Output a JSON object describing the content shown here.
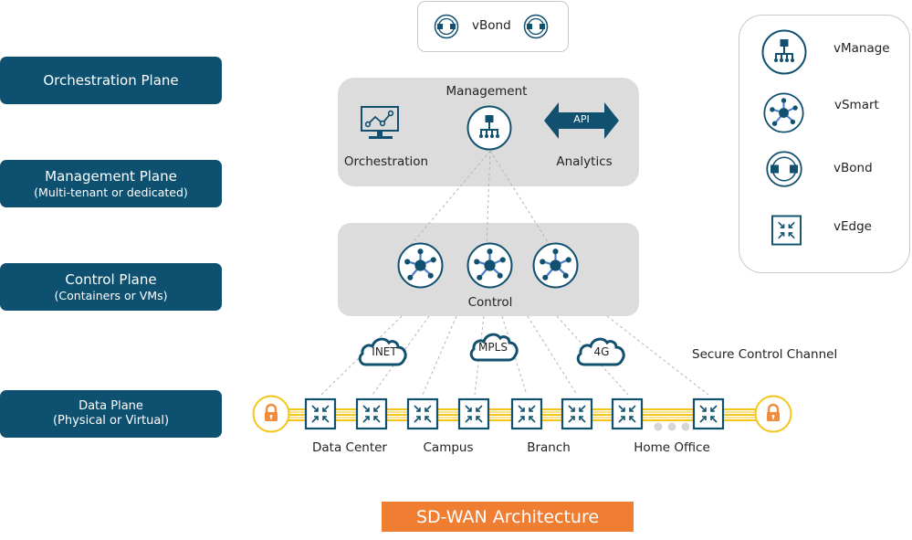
{
  "planes": [
    {
      "title": "Orchestration Plane",
      "subtitle": ""
    },
    {
      "title": "Management Plane",
      "subtitle": "(Multi-tenant or dedicated)"
    },
    {
      "title": "Control Plane",
      "subtitle": "(Containers or VMs)"
    },
    {
      "title": "Data Plane",
      "subtitle": "(Physical or Virtual)"
    }
  ],
  "vbond_box": {
    "label": "vBond",
    "icon": "vbond-icon"
  },
  "management_box": {
    "title": "Management",
    "orchestration_label": "Orchestration",
    "analytics_label": "Analytics",
    "api_label": "API",
    "icons": [
      "monitor-chart-icon",
      "vmanage-icon",
      "api-arrow-icon"
    ]
  },
  "control_box": {
    "label": "Control",
    "vsmart_count": 3
  },
  "transports": [
    {
      "label": "INET",
      "icon": "cloud-icon"
    },
    {
      "label": "MPLS",
      "icon": "cloud-icon"
    },
    {
      "label": "4G",
      "icon": "cloud-icon"
    }
  ],
  "secure_channel_label": "Secure Control Channel",
  "sites": [
    {
      "label": "Data Center",
      "vedge_count": 2
    },
    {
      "label": "Campus",
      "vedge_count": 2
    },
    {
      "label": "Branch",
      "vedge_count": 2
    },
    {
      "label": "Home Office",
      "vedge_count": 2
    }
  ],
  "legend": [
    {
      "label": "vManage",
      "icon": "vmanage-icon"
    },
    {
      "label": "vSmart",
      "icon": "vsmart-icon"
    },
    {
      "label": "vBond",
      "icon": "vbond-icon"
    },
    {
      "label": "vEdge",
      "icon": "vedge-icon"
    }
  ],
  "banner": "SD-WAN Architecture",
  "colors": {
    "plane_bg": "#0e5070",
    "icon_blue": "#11506f",
    "spoke_blue": "#4a7fd0",
    "box_gray": "#dcdcdc",
    "transport_yellow": "#f5c518",
    "lock_orange": "#f08c3c",
    "banner_orange": "#ef7d32"
  }
}
